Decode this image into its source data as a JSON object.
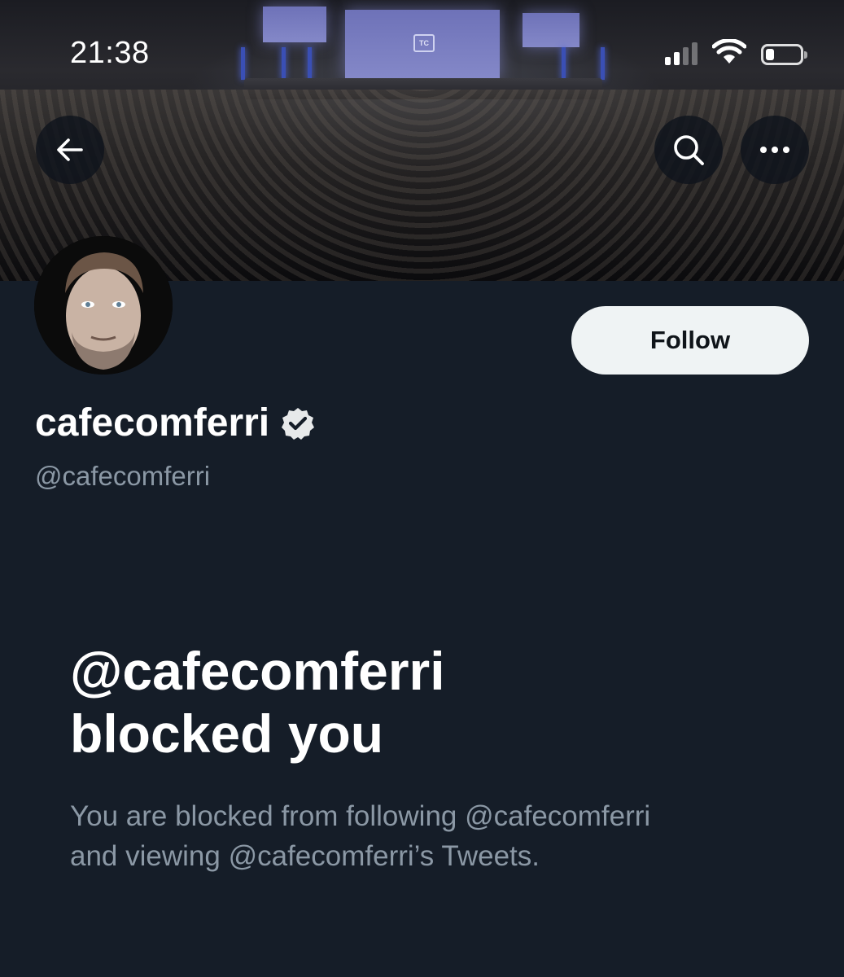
{
  "status_bar": {
    "time": "21:38",
    "icons": [
      "cellular-signal-icon",
      "wifi-icon",
      "battery-icon"
    ],
    "battery_level": 0.25
  },
  "header": {
    "back_icon": "arrow-left-icon",
    "search_icon": "search-icon",
    "more_icon": "more-horizontal-icon"
  },
  "profile": {
    "display_name": "cafecomferri",
    "verified_icon": "verified-badge-icon",
    "handle": "@cafecomferri",
    "follow_label": "Follow"
  },
  "banner": {
    "screen_logo": "TC"
  },
  "blocked": {
    "title_line1": "@cafecomferri",
    "title_line2": "blocked you",
    "desc_line1": "You are blocked from following @cafecomferri",
    "desc_line2": "and viewing @cafecomferri’s Tweets."
  },
  "colors": {
    "background": "#151d28",
    "follow_button": "#eff3f4",
    "secondary_text": "#8b98a5"
  }
}
